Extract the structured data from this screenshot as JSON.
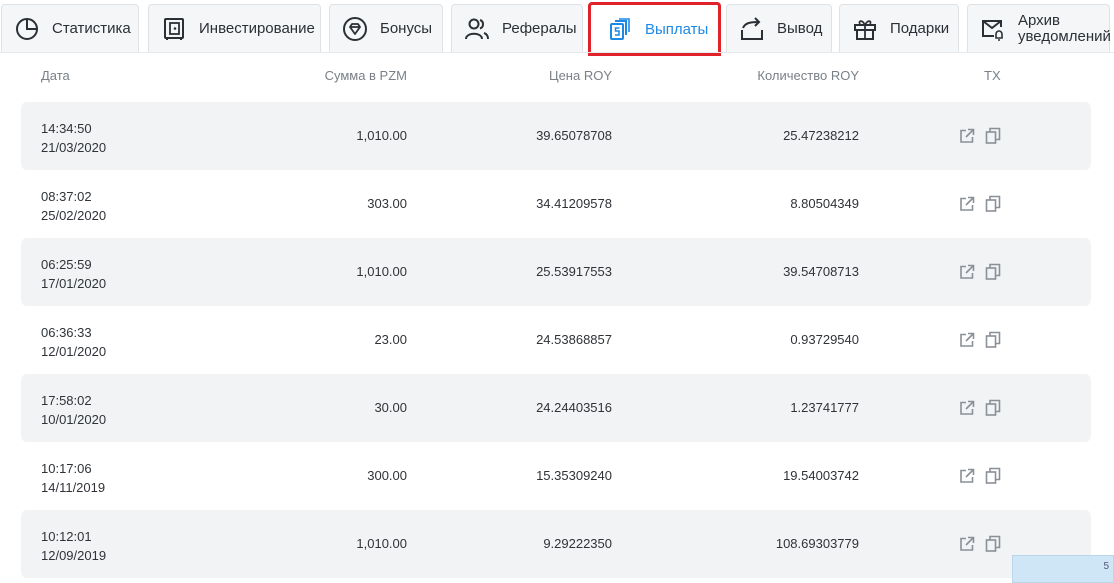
{
  "tabs": [
    {
      "label": "Статистика",
      "icon": "pie-chart-icon"
    },
    {
      "label": "Инвестирование",
      "icon": "safe-icon"
    },
    {
      "label": "Бонусы",
      "icon": "diamond-badge-icon"
    },
    {
      "label": "Рефералы",
      "icon": "users-icon"
    },
    {
      "label": "Выплаты",
      "icon": "payouts-icon",
      "active": true
    },
    {
      "label": "Вывод",
      "icon": "withdraw-arrow-icon"
    },
    {
      "label": "Подарки",
      "icon": "gift-icon"
    },
    {
      "label_line1": "Архив",
      "label_line2": "уведомлений",
      "icon": "mail-bell-icon"
    }
  ],
  "table": {
    "headers": {
      "date": "Дата",
      "amount": "Сумма в PZM",
      "price": "Цена ROY",
      "quantity": "Количество ROY",
      "tx": "TX"
    },
    "rows": [
      {
        "time": "14:34:50",
        "date": "21/03/2020",
        "amount": "1,010.00",
        "price": "39.65078708",
        "quantity": "25.47238212"
      },
      {
        "time": "08:37:02",
        "date": "25/02/2020",
        "amount": "303.00",
        "price": "34.41209578",
        "quantity": "8.80504349"
      },
      {
        "time": "06:25:59",
        "date": "17/01/2020",
        "amount": "1,010.00",
        "price": "25.53917553",
        "quantity": "39.54708713"
      },
      {
        "time": "06:36:33",
        "date": "12/01/2020",
        "amount": "23.00",
        "price": "24.53868857",
        "quantity": "0.93729540"
      },
      {
        "time": "17:58:02",
        "date": "10/01/2020",
        "amount": "30.00",
        "price": "24.24403516",
        "quantity": "1.23741777"
      },
      {
        "time": "10:17:06",
        "date": "14/11/2019",
        "amount": "300.00",
        "price": "15.35309240",
        "quantity": "19.54003742"
      },
      {
        "time": "10:12:01",
        "date": "12/09/2019",
        "amount": "1,010.00",
        "price": "9.29222350",
        "quantity": "108.69303779"
      }
    ]
  },
  "corner_chip": "5",
  "colors": {
    "accent": "#1e88e5",
    "active_border": "#e0222a",
    "row_shade": "#f2f3f5",
    "icon": "#2b3037",
    "tx_icon": "#8a9098"
  }
}
